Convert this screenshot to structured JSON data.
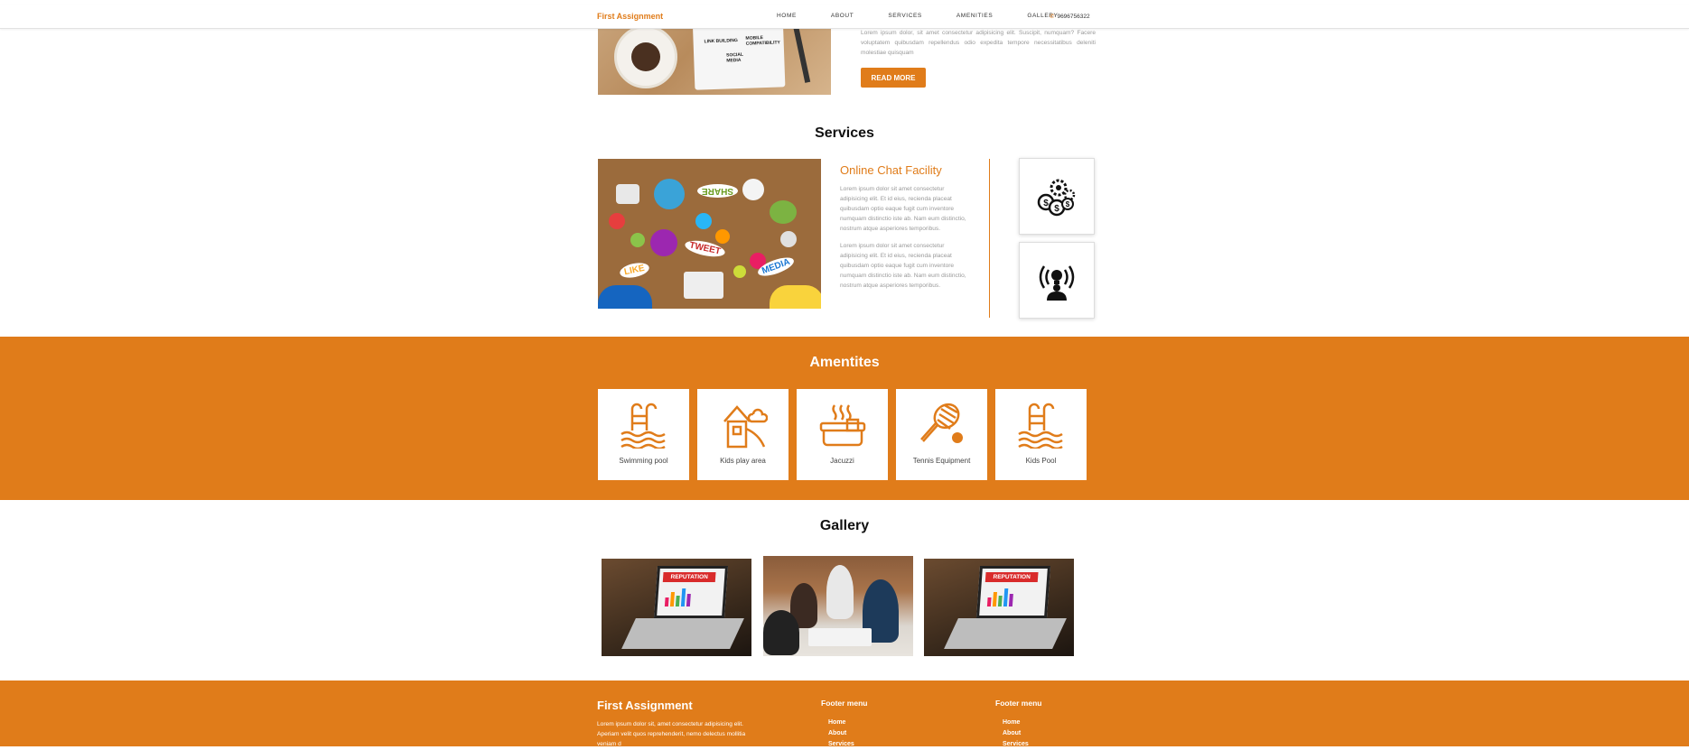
{
  "navbar": {
    "brand": "First Assignment",
    "links": [
      "HOME",
      "ABOUT",
      "SERVICES",
      "AMENITIES",
      "GALLERY"
    ],
    "phone": "9696756322"
  },
  "about": {
    "text": "Lorem ipsum dolor, sit amet consectetur adipisicing elit. Suscipit, numquam? Facere voluptatem quibusdam repellendus odio expedita tempore necessitatibus deleniti molestiae quisquam",
    "button_label": "READ MORE",
    "image_words": [
      "LINK BUILDING",
      "MOBILE COMPATIBILITY",
      "SOCIAL MEDIA"
    ]
  },
  "services": {
    "title": "Services",
    "heading": "Online Chat Facility",
    "paragraphs": [
      "Lorem ipsum dolor sit amet consectetur adipisicing elit. Et id eius, recienda placeat quibusdam optio eaque fugit cum inventore numquam distinctio iste ab. Nam eum distinctio, nostrum atque asperiores temporibus.",
      "Lorem ipsum dolor sit amet consectetur adipisicing elit. Et id eius, recienda placeat quibusdam optio eaque fugit cum inventore numquam distinctio iste ab. Nam eum distinctio, nostrum atque asperiores temporibus."
    ],
    "image_words": [
      "SHARE",
      "TWEET",
      "LIKE",
      "MEDIA"
    ],
    "icons": [
      "money-gears-icon",
      "idea-broadcast-icon"
    ]
  },
  "amenities": {
    "title": "Amentites",
    "items": [
      {
        "label": "Swimming pool",
        "icon": "pool-ladder-icon"
      },
      {
        "label": "Kids play area",
        "icon": "playhouse-icon"
      },
      {
        "label": "Jacuzzi",
        "icon": "jacuzzi-icon"
      },
      {
        "label": "Tennis Equipment",
        "icon": "tennis-racket-icon"
      },
      {
        "label": "Kids Pool",
        "icon": "pool-ladder-icon"
      }
    ]
  },
  "gallery": {
    "title": "Gallery",
    "banner_text": "REPUTATION"
  },
  "footer": {
    "brand": "First Assignment",
    "text": "Lorem ipsum dolor sit, amet consectetur adipisicing elit. Aperiam velit quos reprehenderit, nemo delectus mollitia veniam d",
    "menu_title_1": "Footer menu",
    "menu_title_2": "Footer menu",
    "menu_1": [
      "Home",
      "About",
      "Services"
    ],
    "menu_2": [
      "Home",
      "About",
      "Services"
    ]
  },
  "colors": {
    "accent": "#e07c1a"
  }
}
